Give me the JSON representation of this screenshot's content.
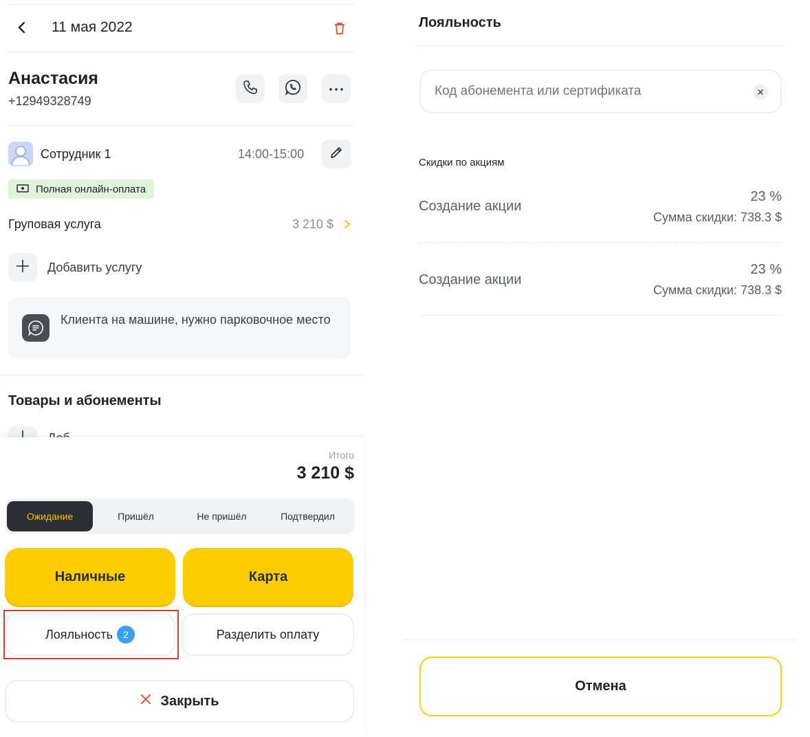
{
  "left": {
    "header": {
      "back_icon": "chevron-left-icon",
      "date": "11 мая 2022",
      "delete_icon": "trash-icon",
      "accent_delete": "#e8593a"
    },
    "client": {
      "name": "Анастасия",
      "phone": "+12949328749"
    },
    "actions": {
      "call_icon": "phone-icon",
      "whatsapp_icon": "whatsapp-icon",
      "more_icon": "more-icon"
    },
    "employee": {
      "name": "Сотрудник 1",
      "time": "14:00-15:00"
    },
    "payment_tag": "Полная онлайн-оплата",
    "service": {
      "name": "Груповая услуга",
      "price": "3 210 $"
    },
    "add_service": "Добавить услугу",
    "note": "Клиента на машине, нужно парковочное место",
    "goods_title": "Товары и абонементы",
    "goods_add_partial": "Доб",
    "total_label": "Итого",
    "total_value": "3 210 $",
    "statuses": [
      "Ожидание",
      "Пришёл",
      "Не пришёл",
      "Подтвердил"
    ],
    "cash_label": "Наличные",
    "card_label": "Карта",
    "loyalty_label": "Лояльность",
    "loyalty_count": "2",
    "split_label": "Разделить оплату",
    "close_label": "Закрыть",
    "colors": {
      "yellow": "#ffcc00",
      "dark": "#2b2e33",
      "highlight": "#e03a2e",
      "badge": "#3aa0f0"
    }
  },
  "right": {
    "title": "Лояльность",
    "code_input": {
      "placeholder": "Код абонемента или сертификата",
      "value": ""
    },
    "discounts_title": "Скидки по акциям",
    "discounts": [
      {
        "name": "Создание акции",
        "percent": "23 %",
        "sum": "Сумма скидки: 738.3 $"
      },
      {
        "name": "Создание акции",
        "percent": "23 %",
        "sum": "Сумма скидки: 738.3 $"
      }
    ],
    "cancel_label": "Отмена"
  }
}
